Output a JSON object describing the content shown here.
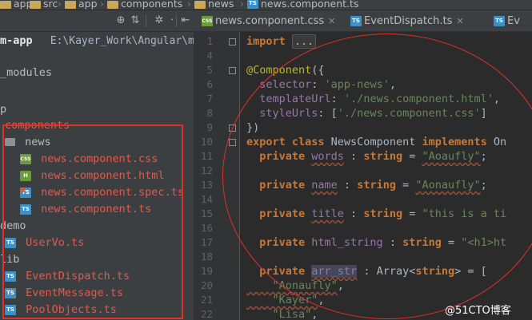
{
  "breadcrumb": {
    "items": [
      "app",
      "src",
      "app",
      "components",
      "news",
      "news.component.ts"
    ]
  },
  "project": {
    "root_name": "m-app",
    "root_path": "E:\\Kayer_Work\\Angular\\m",
    "rows": [
      {
        "label": "_modules",
        "color": "normal",
        "icon": "none"
      },
      {
        "label": "p",
        "color": "normal",
        "icon": "none"
      },
      {
        "label": "components",
        "color": "red",
        "icon": "none"
      },
      {
        "label": "news",
        "color": "normal",
        "icon": "folder"
      },
      {
        "label": "news.component.css",
        "color": "red",
        "icon": "css"
      },
      {
        "label": "news.component.html",
        "color": "red",
        "icon": "html"
      },
      {
        "label": "news.component.spec.ts",
        "color": "red",
        "icon": "spec"
      },
      {
        "label": "news.component.ts",
        "color": "red",
        "icon": "ts"
      },
      {
        "label": "demo",
        "color": "normal",
        "icon": "none"
      },
      {
        "label": "UserVo.ts",
        "color": "red",
        "icon": "ts"
      },
      {
        "label": "lib",
        "color": "normal",
        "icon": "none"
      },
      {
        "label": "EventDispatch.ts",
        "color": "red",
        "icon": "ts"
      },
      {
        "label": "EventMessage.ts",
        "color": "red",
        "icon": "ts"
      },
      {
        "label": "PoolObjects.ts",
        "color": "red",
        "icon": "ts"
      }
    ]
  },
  "tabs": [
    {
      "label": "news.component.css",
      "icon": "css",
      "active": false
    },
    {
      "label": "EventDispatch.ts",
      "icon": "ts",
      "active": false
    },
    {
      "label": "Ev",
      "icon": "ts",
      "active": false
    }
  ],
  "editor": {
    "line_numbers": [
      "1",
      "4",
      "5",
      "6",
      "7",
      "8",
      "9",
      "10",
      "11",
      "12",
      "13",
      "14",
      "15",
      "16",
      "17",
      "18",
      "19",
      "20",
      "21",
      "22"
    ],
    "lines": [
      [
        {
          "t": "import ",
          "c": "kw"
        },
        {
          "t": "...",
          "c": "fold-txt"
        }
      ],
      [],
      [
        {
          "t": "@Component",
          "c": "ann"
        },
        {
          "t": "({",
          "c": "plain"
        }
      ],
      [
        {
          "t": "  selector",
          "c": "prop"
        },
        {
          "t": ": ",
          "c": "plain"
        },
        {
          "t": "'app-news'",
          "c": "str"
        },
        {
          "t": ",",
          "c": "plain"
        }
      ],
      [
        {
          "t": "  templateUrl",
          "c": "prop"
        },
        {
          "t": ": ",
          "c": "plain"
        },
        {
          "t": "'./news.component.html'",
          "c": "str"
        },
        {
          "t": ",",
          "c": "plain"
        }
      ],
      [
        {
          "t": "  styleUrls",
          "c": "prop"
        },
        {
          "t": ": [",
          "c": "plain"
        },
        {
          "t": "'./news.component.css'",
          "c": "str"
        },
        {
          "t": "]",
          "c": "plain"
        }
      ],
      [
        {
          "t": "})",
          "c": "plain"
        }
      ],
      [
        {
          "t": "export class ",
          "c": "kw"
        },
        {
          "t": "NewsComponent ",
          "c": "plain"
        },
        {
          "t": "implements ",
          "c": "kw"
        },
        {
          "t": "On",
          "c": "plain"
        }
      ],
      [
        {
          "t": "  private ",
          "c": "kw"
        },
        {
          "t": "words",
          "c": "fld wavy"
        },
        {
          "t": " : ",
          "c": "plain"
        },
        {
          "t": "string",
          "c": "kw"
        },
        {
          "t": " = ",
          "c": "plain"
        },
        {
          "t": "\"Aoaufly\"",
          "c": "str wavy"
        },
        {
          "t": ";",
          "c": "plain"
        }
      ],
      [],
      [
        {
          "t": "  private ",
          "c": "kw"
        },
        {
          "t": "name",
          "c": "fld wavy"
        },
        {
          "t": " : ",
          "c": "plain"
        },
        {
          "t": "string",
          "c": "kw"
        },
        {
          "t": " = ",
          "c": "plain"
        },
        {
          "t": "\"Aonaufly\"",
          "c": "str wavy"
        },
        {
          "t": ";",
          "c": "plain"
        }
      ],
      [],
      [
        {
          "t": "  private ",
          "c": "kw"
        },
        {
          "t": "title",
          "c": "fld wavy"
        },
        {
          "t": " : ",
          "c": "plain"
        },
        {
          "t": "string",
          "c": "kw"
        },
        {
          "t": " = ",
          "c": "plain"
        },
        {
          "t": "\"this is a ti",
          "c": "str"
        }
      ],
      [],
      [
        {
          "t": "  private ",
          "c": "kw"
        },
        {
          "t": "html_string",
          "c": "fld"
        },
        {
          "t": " : ",
          "c": "plain"
        },
        {
          "t": "string",
          "c": "kw"
        },
        {
          "t": " = ",
          "c": "plain"
        },
        {
          "t": "\"<h1>ht",
          "c": "str"
        }
      ],
      [],
      [
        {
          "t": "  private ",
          "c": "kw"
        },
        {
          "t": "arr_str",
          "c": "fld sel wavy"
        },
        {
          "t": " : ",
          "c": "plain"
        },
        {
          "t": "Array<",
          "c": "plain"
        },
        {
          "t": "string",
          "c": "kw"
        },
        {
          "t": "> = [",
          "c": "plain"
        }
      ],
      [
        {
          "t": "    \"Aonaufly\"",
          "c": "str wavy"
        },
        {
          "t": ",",
          "c": "plain"
        }
      ],
      [
        {
          "t": "    \"Kayer\"",
          "c": "str wavy"
        },
        {
          "t": ",",
          "c": "plain"
        }
      ],
      [
        {
          "t": "    \"Lisa\"",
          "c": "str wavy"
        },
        {
          "t": ",",
          "c": "plain"
        }
      ]
    ]
  },
  "watermark": "@51CTO博客",
  "colors": {
    "annotation_red": "#e0312a",
    "vcs_unversioned": "#e05a4e",
    "keyword": "#cc7832",
    "string": "#6a8759"
  }
}
